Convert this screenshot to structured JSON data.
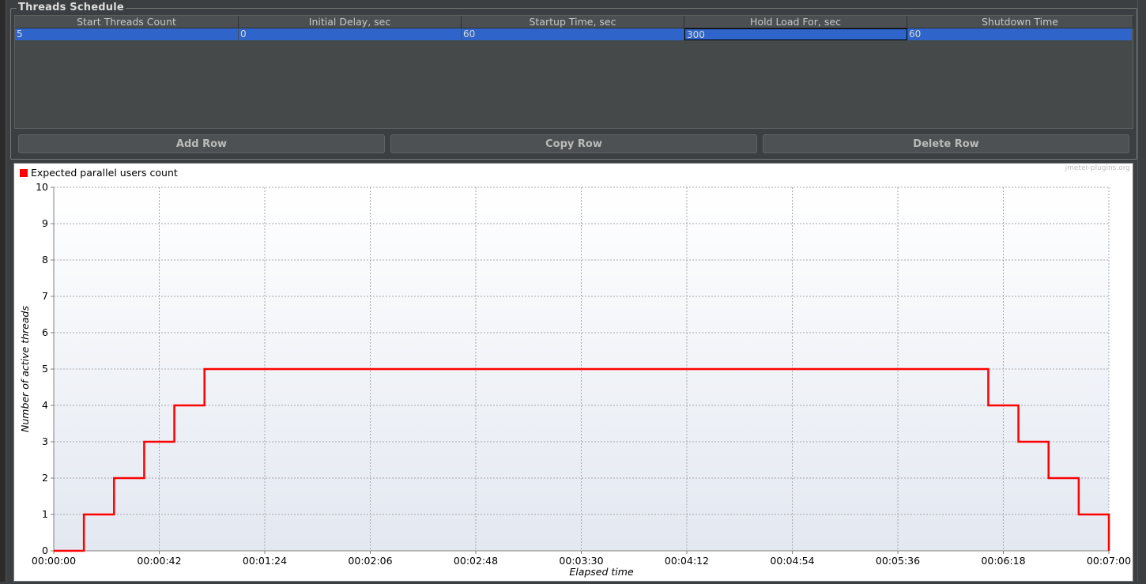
{
  "schedule": {
    "title": "Threads Schedule",
    "columns": [
      "Start Threads Count",
      "Initial Delay, sec",
      "Startup Time, sec",
      "Hold Load For, sec",
      "Shutdown Time"
    ],
    "rows": [
      [
        "5",
        "0",
        "60",
        "300",
        "60"
      ]
    ],
    "selected_row": 0,
    "focused_cell": 3,
    "buttons": {
      "add": "Add Row",
      "copy": "Copy Row",
      "delete": "Delete Row"
    }
  },
  "colors": {
    "selection": "#2f65ca",
    "series": "#ff0000",
    "panel_bg": "#3c3f41"
  },
  "chart_data": {
    "type": "line",
    "title": "",
    "watermark": "jmeter-plugins.org",
    "xlabel": "Elapsed time",
    "ylabel": "Number of active threads",
    "xlim": [
      0,
      420
    ],
    "ylim": [
      0,
      10
    ],
    "x_ticks": [
      "00:00:00",
      "00:00:42",
      "00:01:24",
      "00:02:06",
      "00:02:48",
      "00:03:30",
      "00:04:12",
      "00:04:54",
      "00:05:36",
      "00:06:18",
      "00:07:00"
    ],
    "y_ticks": [
      "0",
      "1",
      "2",
      "3",
      "4",
      "5",
      "6",
      "7",
      "8",
      "9",
      "10"
    ],
    "grid": true,
    "legend_position": "top-left",
    "step": true,
    "series": [
      {
        "name": "Expected parallel users count",
        "color": "#ff0000",
        "x": [
          0,
          12,
          24,
          36,
          48,
          60,
          372,
          384,
          396,
          408,
          420
        ],
        "y": [
          0,
          1,
          2,
          3,
          4,
          5,
          4,
          3,
          2,
          1,
          0
        ]
      }
    ]
  }
}
